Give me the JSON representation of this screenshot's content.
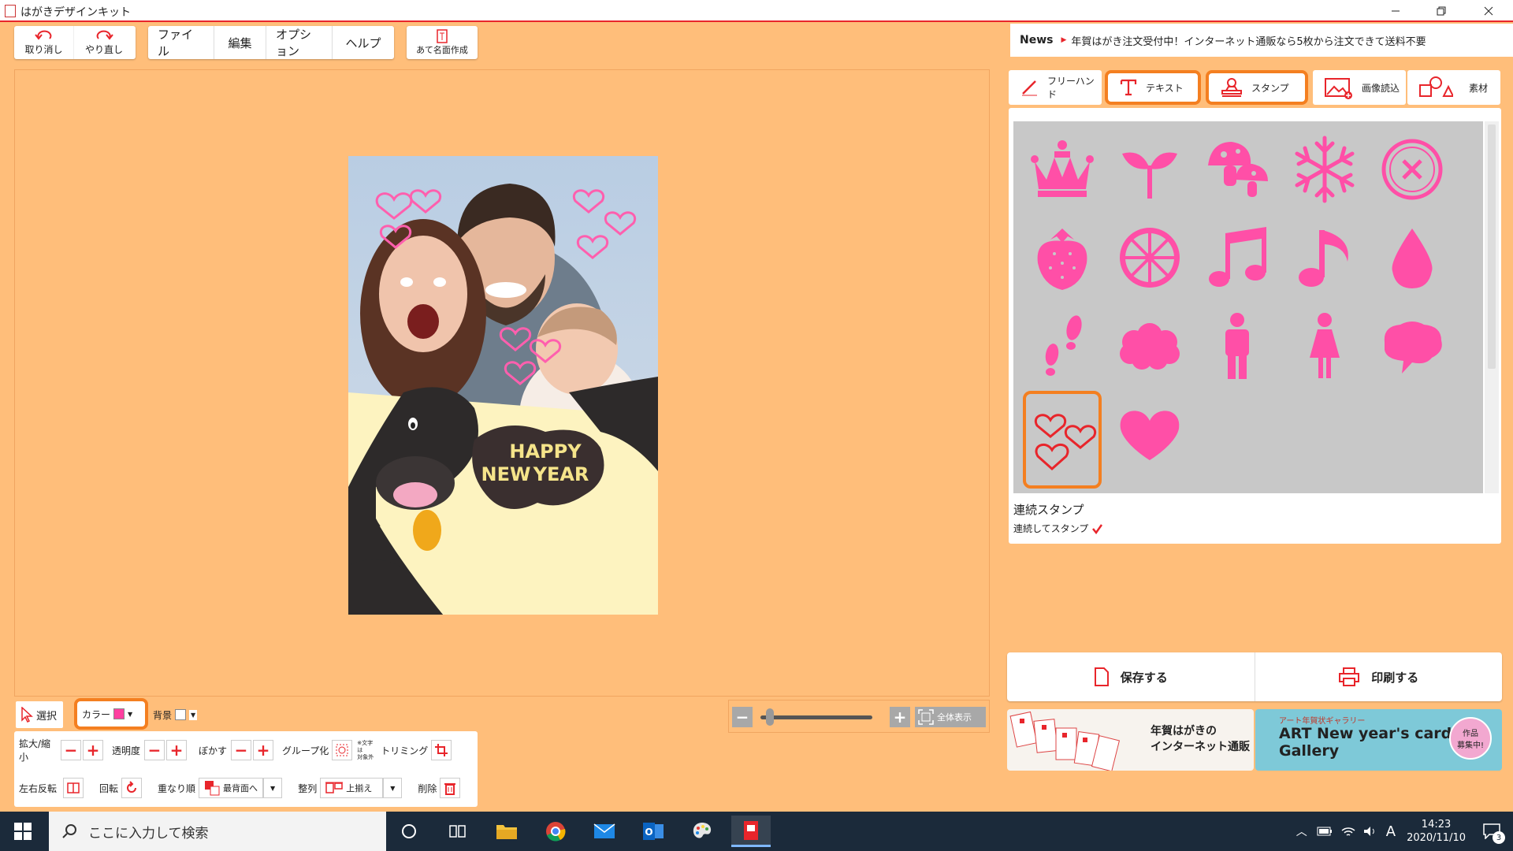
{
  "window": {
    "title": "はがきデザインキット"
  },
  "toolbar": {
    "undo_label": "取り消し",
    "redo_label": "やり直し",
    "menus": [
      "ファイル",
      "編集",
      "オプション",
      "ヘルプ"
    ],
    "address_label": "あて名面作成"
  },
  "news": {
    "label": "News",
    "text": "年賀はがき注文受付中！インターネット通販なら5枚から注文できて送料不要"
  },
  "tabs": [
    {
      "label": "フリーハンド",
      "highlighted": false
    },
    {
      "label": "テキスト",
      "highlighted": true
    },
    {
      "label": "スタンプ",
      "highlighted": true
    },
    {
      "label": "画像読込",
      "highlighted": false
    },
    {
      "label": "素材",
      "highlighted": false
    }
  ],
  "stamps": {
    "color": "#ff4fa7",
    "items": [
      "crown-icon",
      "sprout-icon",
      "mushroom-icon",
      "snowflake-icon",
      "button-icon",
      "strawberry-icon",
      "orange-slice-icon",
      "music-notes-icon",
      "music-note-icon",
      "drop-icon",
      "footprints-icon",
      "cloud-icon",
      "man-icon",
      "woman-icon",
      "speech-bubble-icon",
      "hearts-outline-icon",
      "heart-icon"
    ],
    "selected": "hearts-outline-icon",
    "continuous_title": "連続スタンプ",
    "continuous_label": "連続してスタンプ",
    "continuous_checked": true
  },
  "actions": {
    "save_label": "保存する",
    "print_label": "印刷する"
  },
  "banners": {
    "left_text_1": "年賀はがきの",
    "left_text_2": "インターネット通販",
    "right_subtitle": "アート年賀状ギャラリー",
    "right_title_1": "ART New year's card",
    "right_title_2": "Gallery",
    "right_badge_1": "作品",
    "right_badge_2": "募集中!"
  },
  "props": {
    "select_label": "選択",
    "color_label": "カラー",
    "color_value": "#ff3fa0",
    "background_label": "背景"
  },
  "tools": {
    "scale_label": "拡大/縮小",
    "opacity_label": "透明度",
    "blur_label": "ぼかす",
    "group_label": "グループ化",
    "group_note_1": "※文字は",
    "group_note_2": "対象外",
    "trim_label": "トリミング",
    "flip_label": "左右反転",
    "rotate_label": "回転",
    "order_label": "重なり順",
    "order_value": "最背面へ",
    "align_label": "整列",
    "align_value": "上揃え",
    "delete_label": "削除"
  },
  "zoom": {
    "fit_label": "全体表示",
    "level": 0.05
  },
  "postcard": {
    "greeting_1": "HAPPY",
    "greeting_2": "NEW",
    "greeting_3": "YEAR"
  },
  "taskbar": {
    "search_placeholder": "ここに入力して検索",
    "time": "14:23",
    "date": "2020/11/10",
    "ime": "A",
    "notification_count": "3"
  }
}
